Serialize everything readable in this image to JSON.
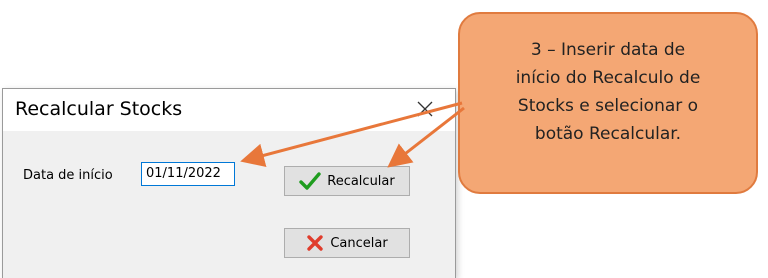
{
  "dialog": {
    "title": "Recalcular Stocks",
    "date_label": "Data de início",
    "date_value": "01/11/2022",
    "recalc_label": "Recalcular",
    "cancel_label": "Cancelar",
    "close_icon": "close-icon",
    "recalc_icon": "checkmark-icon",
    "cancel_icon": "x-icon"
  },
  "callout": {
    "text": "3 – Inserir data de\ninício do Recalculo de\nStocks e selecionar o\nbotão Recalcular."
  },
  "colors": {
    "callout_fill": "#f4a774",
    "callout_border": "#e07b3f",
    "arrow": "#e8773a",
    "input_focus": "#0078d7",
    "check_green": "#1f9d1f",
    "x_red": "#e03c2c"
  }
}
